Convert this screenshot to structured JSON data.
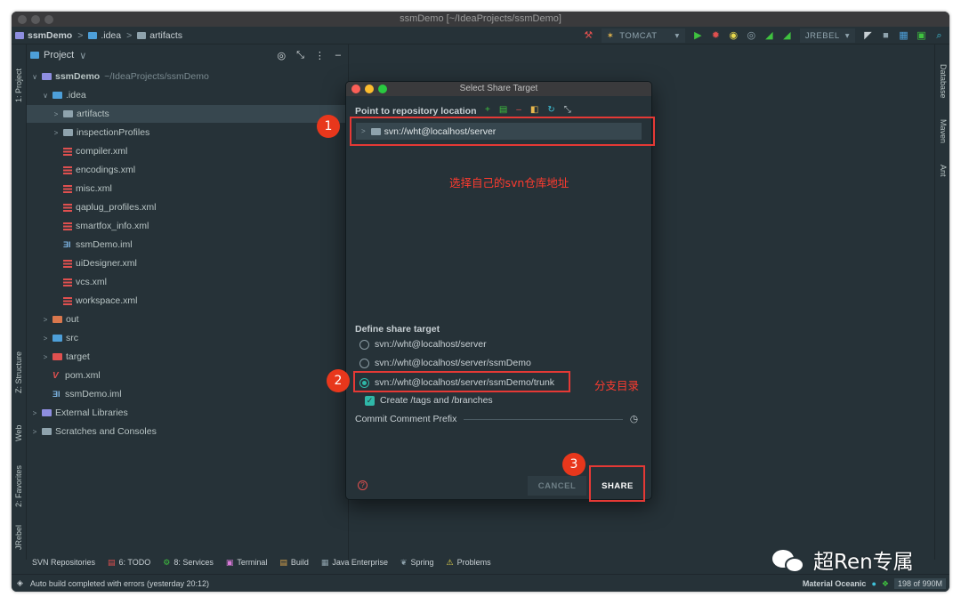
{
  "window": {
    "title": "ssmDemo [~/IdeaProjects/ssmDemo]"
  },
  "navbar": {
    "crumbs": [
      "ssmDemo",
      ".idea",
      "artifacts"
    ],
    "tomcat": "TOMCAT",
    "jrebel": "JREBEL"
  },
  "left_stripe": {
    "project": "1: Project",
    "structure": "Z: Structure",
    "web": "Web",
    "favorites": "2: Favorites",
    "jrebel": "JRebel"
  },
  "right_stripe": {
    "database": "Database",
    "maven": "Maven",
    "ant": "Ant"
  },
  "project_panel": {
    "title": "Project",
    "tree": [
      {
        "label": "ssmDemo",
        "extra": "~/IdeaProjects/ssmDemo"
      },
      {
        "label": ".idea"
      },
      {
        "label": "artifacts"
      },
      {
        "label": "inspectionProfiles"
      },
      {
        "label": "compiler.xml"
      },
      {
        "label": "encodings.xml"
      },
      {
        "label": "misc.xml"
      },
      {
        "label": "qaplug_profiles.xml"
      },
      {
        "label": "smartfox_info.xml"
      },
      {
        "label": "ssmDemo.iml"
      },
      {
        "label": "uiDesigner.xml"
      },
      {
        "label": "vcs.xml"
      },
      {
        "label": "workspace.xml"
      },
      {
        "label": "out"
      },
      {
        "label": "src"
      },
      {
        "label": "target"
      },
      {
        "label": "pom.xml"
      },
      {
        "label": "ssmDemo.iml"
      },
      {
        "label": "External Libraries"
      },
      {
        "label": "Scratches and Consoles"
      }
    ]
  },
  "dialog": {
    "title": "Select Share Target",
    "point_label": "Point to repository location",
    "repo_entry": "svn://wht@localhost/server",
    "define_label": "Define share target",
    "options": [
      "svn://wht@localhost/server",
      "svn://wht@localhost/server/ssmDemo",
      "svn://wht@localhost/server/ssmDemo/trunk"
    ],
    "selected_option_index": 2,
    "create_tags_label": "Create /tags and /branches",
    "create_tags_checked": true,
    "commit_prefix_label": "Commit Comment Prefix",
    "cancel_label": "CANCEL",
    "share_label": "SHARE"
  },
  "annotations": {
    "badge1": "1",
    "badge2": "2",
    "badge3": "3",
    "note1": "选择自己的svn仓库地址",
    "note2": "分支目录"
  },
  "bottom_tabs": {
    "svn": "SVN Repositories",
    "todo": "6: TODO",
    "services": "8: Services",
    "terminal": "Terminal",
    "build": "Build",
    "java_enterprise": "Java Enterprise",
    "spring": "Spring",
    "problems": "Problems"
  },
  "statusbar": {
    "message": "Auto build completed with errors (yesterday 20:12)",
    "theme": "Material Oceanic",
    "memory": "198 of 990M"
  },
  "watermark": {
    "text": "超Ren专属"
  },
  "colors": {
    "background": "#263238",
    "accent": "#2fb8a8",
    "annotation_red": "#e53935"
  }
}
